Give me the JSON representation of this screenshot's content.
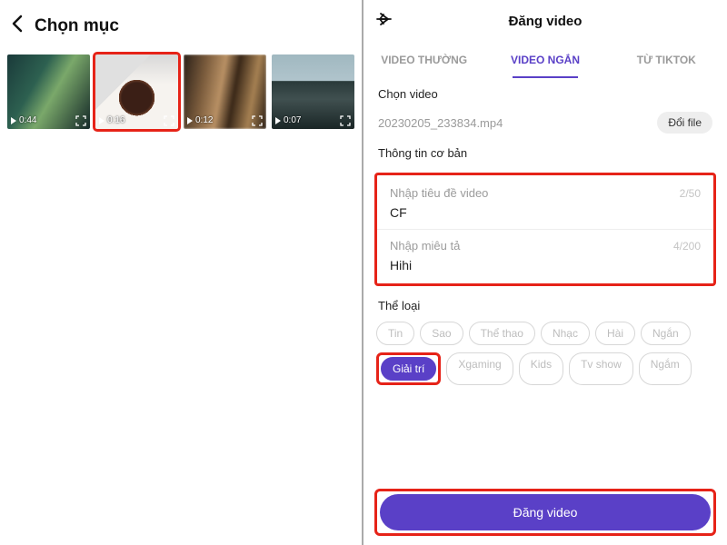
{
  "left": {
    "title": "Chọn mục",
    "thumbs": [
      {
        "duration": "0:44",
        "highlighted": false
      },
      {
        "duration": "0:16",
        "highlighted": true
      },
      {
        "duration": "0:12",
        "highlighted": false
      },
      {
        "duration": "0:07",
        "highlighted": false
      }
    ]
  },
  "right": {
    "title": "Đăng video",
    "tabs": [
      {
        "label": "VIDEO THƯỜNG",
        "active": false
      },
      {
        "label": "VIDEO NGẮN",
        "active": true
      },
      {
        "label": "TỪ TIKTOK",
        "active": false
      }
    ],
    "choose_video_label": "Chọn video",
    "file_name": "20230205_233834.mp4",
    "change_file_label": "Đổi file",
    "basic_info_label": "Thông tin cơ bản",
    "title_field": {
      "label": "Nhập tiêu đề video",
      "value": "CF",
      "counter": "2/50"
    },
    "desc_field": {
      "label": "Nhập miêu tả",
      "value": "Hihi",
      "counter": "4/200"
    },
    "category_label": "Thể loại",
    "chips_row1": [
      "Tin",
      "Sao",
      "Thể thao",
      "Nhạc",
      "Hài",
      "Ngắn"
    ],
    "chip_selected": "Giải trí",
    "chips_row2": [
      "Xgaming",
      "Kids",
      "Tv show",
      "Ngắm"
    ],
    "submit_label": "Đăng video"
  }
}
